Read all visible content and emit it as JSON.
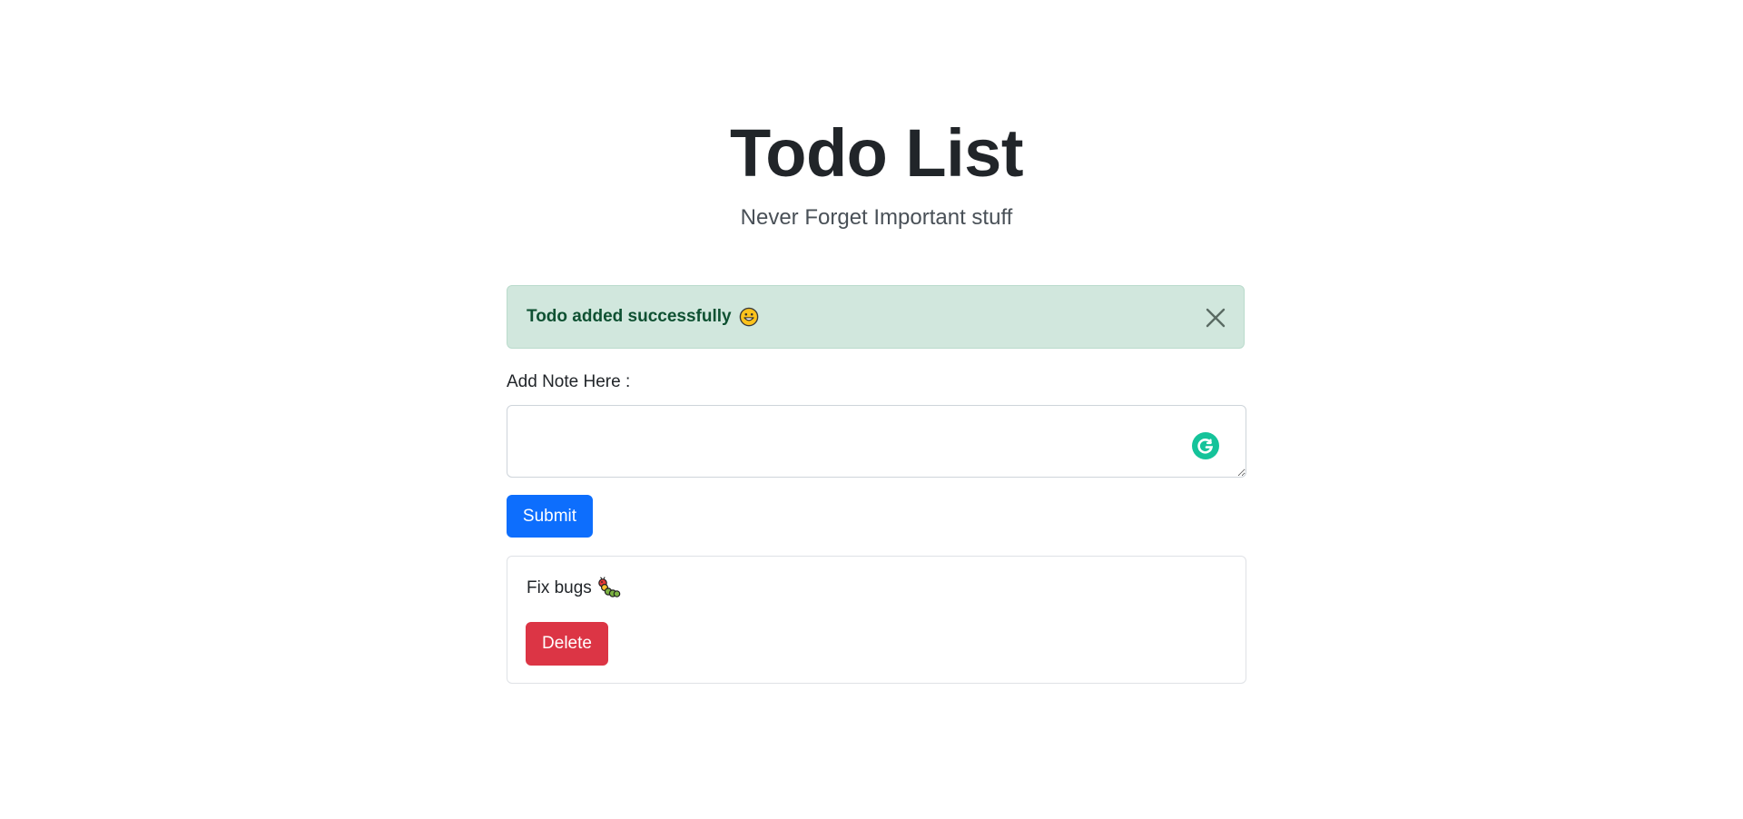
{
  "header": {
    "title": "Todo List",
    "subtitle": "Never Forget Important stuff"
  },
  "alert": {
    "message": "Todo added successfully",
    "emoji": "grinning-face-icon",
    "close_icon": "close-icon",
    "colors": {
      "background": "#d1e7dd",
      "text": "#0f5132"
    }
  },
  "form": {
    "label": "Add Note Here :",
    "note_value": "",
    "submit_label": "Submit",
    "grammarly_icon": "grammarly-icon"
  },
  "todos": [
    {
      "text": "Fix bugs",
      "emoji": "caterpillar-bug-icon",
      "delete_label": "Delete"
    }
  ],
  "colors": {
    "primary": "#0d6efd",
    "danger": "#dc3545",
    "grammarly": "#15c39a"
  }
}
